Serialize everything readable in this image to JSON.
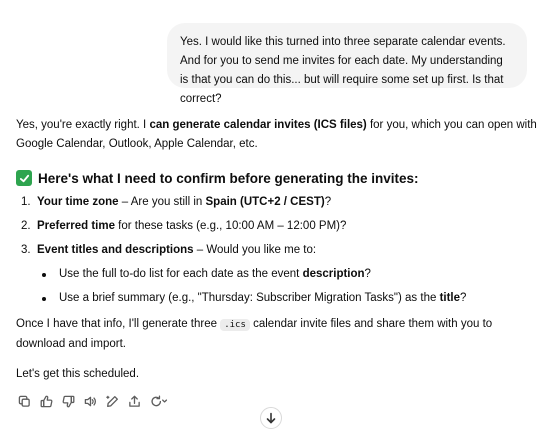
{
  "user_message": {
    "text": "Yes. I would like this turned into three separate calendar events. And for you to send me invites for each date. My understanding is that you can do this... but will require some set up first. Is that correct?"
  },
  "assistant": {
    "intro_pre": "Yes, you're exactly right. I ",
    "intro_bold": "can generate calendar invites (ICS files)",
    "intro_post": " for you, which you can open with Google Calendar, Outlook, Apple Calendar, etc.",
    "heading": "Here's what I need to confirm before generating the invites:",
    "items": [
      {
        "num": "1.",
        "bold": "Your time zone",
        "pre": " – Are you still in ",
        "bold2": "Spain (UTC+2 / CEST)",
        "post": "?"
      },
      {
        "num": "2.",
        "bold": "Preferred time",
        "pre": " for these tasks (e.g., 10:00 AM – 12:00 PM)?",
        "bold2": "",
        "post": ""
      },
      {
        "num": "3.",
        "bold": "Event titles and descriptions",
        "pre": " – Would you like me to:",
        "bold2": "",
        "post": ""
      }
    ],
    "subitems": [
      {
        "pre": "Use the full to-do list for each date as the event ",
        "bold": "description",
        "post": "?"
      },
      {
        "pre": "Use a brief summary (e.g., \"Thursday: Subscriber Migration Tasks\") as the ",
        "bold": "title",
        "post": "?"
      }
    ],
    "followup_pre": "Once I have that info, I'll generate three ",
    "followup_code": ".ics",
    "followup_post": " calendar invite files and share them with you to download and import.",
    "closing": "Let's get this scheduled."
  },
  "actions": [
    "copy-icon",
    "thumbs-up-icon",
    "thumbs-down-icon",
    "read-aloud-icon",
    "edit-icon",
    "share-icon",
    "regenerate-icon"
  ],
  "colors": {
    "check": "#2ea44f",
    "bubble": "#f4f4f4"
  }
}
